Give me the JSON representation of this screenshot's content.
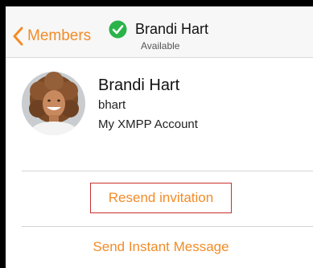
{
  "navbar": {
    "back_label": "Members",
    "title": "Brandi Hart",
    "subtitle": "Available",
    "status_color": "#2bb34a"
  },
  "contact": {
    "name": "Brandi Hart",
    "username": "bhart",
    "account": "My XMPP Account"
  },
  "actions": {
    "resend_label": "Resend invitation",
    "message_label": "Send Instant Message"
  },
  "colors": {
    "accent": "#f28c28",
    "highlight_border": "#c9302c"
  }
}
